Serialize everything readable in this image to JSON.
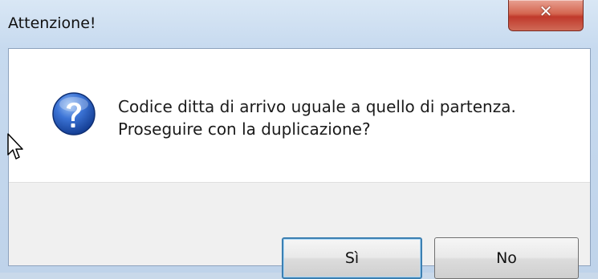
{
  "window": {
    "title": "Attenzione!",
    "close_glyph": "✕"
  },
  "dialog": {
    "icon": "question-icon",
    "message_line1": "Codice ditta di arrivo uguale a quello di partenza.",
    "message_line2": "Proseguire con la duplicazione?"
  },
  "buttons": {
    "yes_label": "Sì",
    "no_label": "No"
  },
  "colors": {
    "title_bar": "#c7daef",
    "close_button": "#c0392b",
    "icon_blue": "#2a5fb8",
    "footer": "#f0f0f0",
    "default_button_border": "#3c7fb1"
  }
}
